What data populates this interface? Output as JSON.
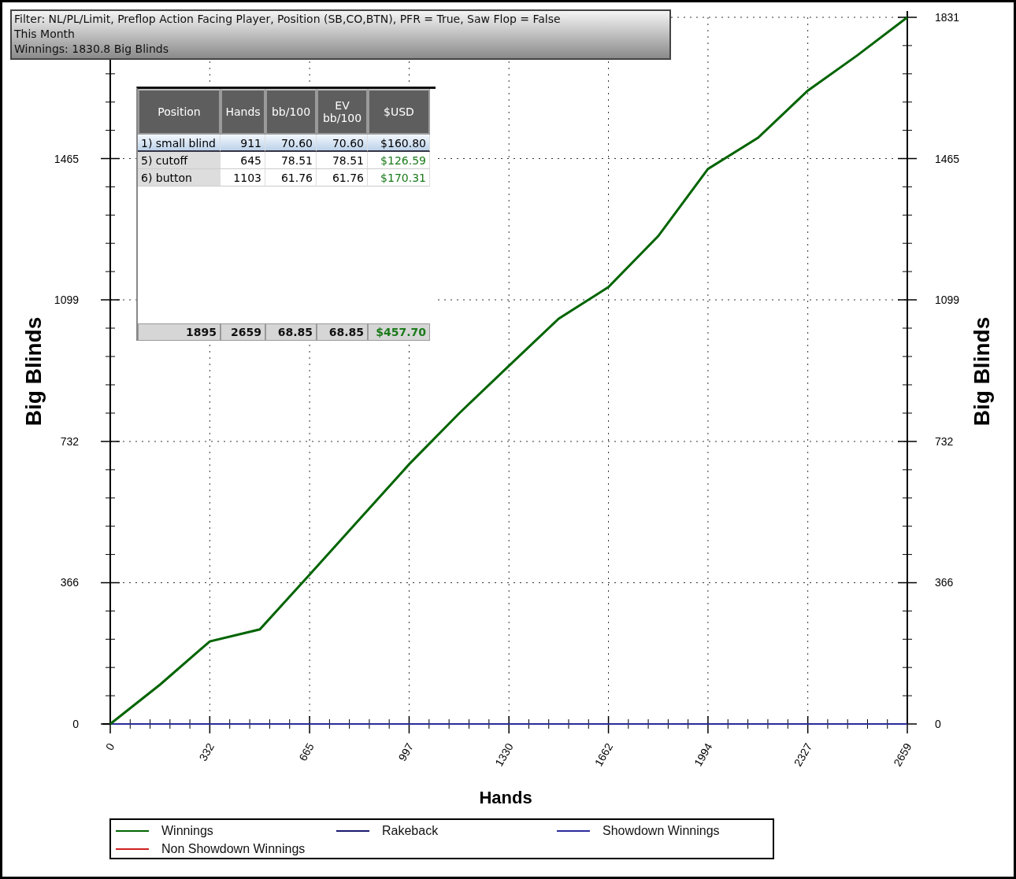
{
  "filter_box": {
    "lines": [
      "Filter: NL/PL/Limit, Preflop Action Facing Player, Position (SB,CO,BTN), PFR = True, Saw Flop = False",
      "This Month",
      "Winnings: 1830.8 Big Blinds"
    ]
  },
  "table": {
    "columns": [
      "Position",
      "Hands",
      "bb/100",
      "EV bb/100",
      "$USD"
    ],
    "rows": [
      {
        "selected": true,
        "cells": [
          "1) small blind",
          "911",
          "70.60",
          "70.60",
          "$160.80"
        ]
      },
      {
        "selected": false,
        "cells": [
          "5) cutoff",
          "645",
          "78.51",
          "78.51",
          "$126.59"
        ]
      },
      {
        "selected": false,
        "cells": [
          "6) button",
          "1103",
          "61.76",
          "61.76",
          "$170.31"
        ]
      }
    ],
    "totals": [
      "1895",
      "2659",
      "68.85",
      "68.85",
      "$457.70"
    ]
  },
  "chart": {
    "chart_data": {
      "type": "line",
      "xlabel": "Hands",
      "ylabel": "Big Blinds",
      "y2label": "Big Blinds",
      "xlim": [
        0,
        2659
      ],
      "ylim": [
        0,
        1831
      ],
      "grid": true,
      "xticks": [
        0,
        332,
        665,
        997,
        1330,
        1662,
        1994,
        2327,
        2659
      ],
      "yticks": [
        0,
        366,
        732,
        1099,
        1465
      ],
      "y2lim": [
        0,
        1831
      ],
      "y2ticks": [
        0,
        366,
        732,
        1099,
        1465,
        1831
      ],
      "x": [
        0,
        166,
        332,
        499,
        665,
        831,
        997,
        1164,
        1330,
        1496,
        1662,
        1828,
        1994,
        2161,
        2327,
        2493,
        2659
      ],
      "series": [
        {
          "name": "Winnings",
          "color": "#006400",
          "values": [
            0,
            102,
            214,
            245,
            387,
            530,
            673,
            805,
            928,
            1050,
            1132,
            1264,
            1438,
            1519,
            1641,
            1733,
            1831
          ]
        },
        {
          "name": "Rakeback",
          "color": "#191970",
          "values": [
            null,
            null,
            null,
            null,
            null,
            null,
            null,
            null,
            null,
            null,
            null,
            null,
            null,
            null,
            null,
            null,
            null
          ]
        },
        {
          "name": "Showdown Winnings",
          "color": "#2b2b9b",
          "values": [
            0,
            0,
            0,
            0,
            0,
            0,
            0,
            0,
            0,
            0,
            0,
            0,
            0,
            0,
            0,
            0,
            0
          ]
        },
        {
          "name": "Non Showdown Winnings",
          "color": "#d02020",
          "values": [
            null,
            null,
            null,
            null,
            null,
            null,
            null,
            null,
            null,
            null,
            null,
            null,
            null,
            null,
            null,
            null,
            null
          ]
        }
      ]
    }
  }
}
